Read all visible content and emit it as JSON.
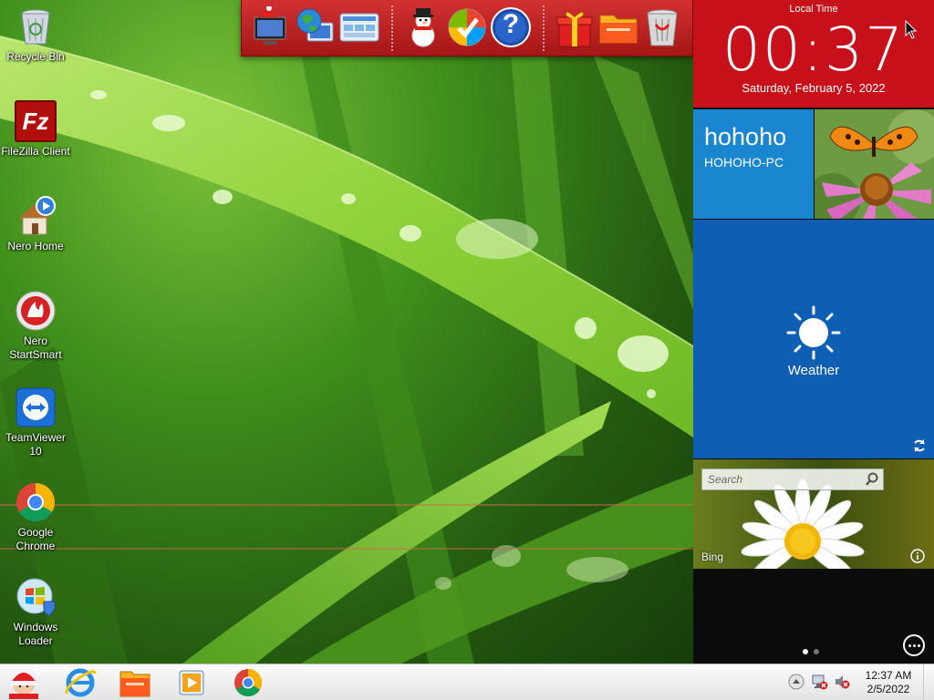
{
  "desktop_icons": [
    {
      "label": "Recycle Bin",
      "icon": "recycle-bin-icon"
    },
    {
      "label": "FileZilla Client",
      "icon": "filezilla-icon"
    },
    {
      "label": "Nero Home",
      "icon": "nero-home-icon"
    },
    {
      "label": "Nero StartSmart",
      "icon": "nero-startsmart-icon"
    },
    {
      "label": "TeamViewer 10",
      "icon": "teamviewer-icon"
    },
    {
      "label": "Google Chrome",
      "icon": "chrome-icon"
    },
    {
      "label": "Windows Loader",
      "icon": "windows-loader-icon"
    }
  ],
  "filezilla_glyph": "Fz",
  "dock": {
    "items": [
      "christmas-pc-icon",
      "globe-network-icon",
      "control-panel-icon",
      "snowman-icon",
      "windows-check-icon",
      "help-icon",
      "gift-icon",
      "folder-icon",
      "trash-icon"
    ],
    "help_glyph": "?"
  },
  "clock_tile": {
    "label": "Local Time",
    "time": "00:37",
    "date": "Saturday, February 5, 2022"
  },
  "user_tile": {
    "name": "hohoho",
    "computer": "HOHOHO-PC"
  },
  "weather_tile": {
    "label": "Weather"
  },
  "bing_tile": {
    "search_placeholder": "Search",
    "label": "Bing"
  },
  "pager": {
    "pages": 2,
    "active": 1
  },
  "taskbar": {
    "items": [
      "start-button-santa",
      "internet-explorer-icon",
      "file-explorer-icon",
      "media-player-icon",
      "chrome-icon"
    ],
    "clock_time": "12:37 AM",
    "clock_date": "2/5/2022"
  },
  "colors": {
    "dock": "#c42222",
    "clock_tile": "#c8101a",
    "user_tile": "#1a86d0",
    "weather_tile": "#0e5fb3",
    "panel_bg": "#0b0b0b",
    "taskbar": "#f2f2f2"
  }
}
